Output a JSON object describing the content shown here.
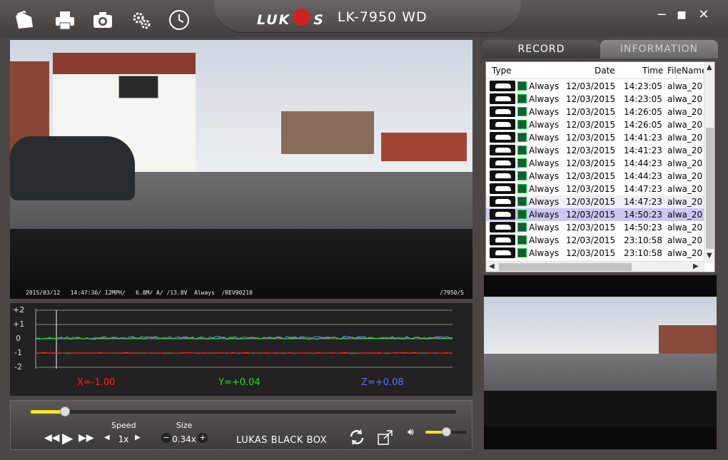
{
  "app": {
    "brand": "LUKAS",
    "model": "LK-7950 WD"
  },
  "toolbar": {
    "icons": [
      "open-folder-icon",
      "print-icon",
      "camera-icon",
      "settings-gears-icon",
      "clock-icon"
    ]
  },
  "window": {
    "minimize": "−",
    "maximize": "■",
    "close": "✕"
  },
  "main_video": {
    "osd_left": "2015/03/12   14:47:36/ 12MPH/   6.8M/ A/ /13.8V  Always  /REV90210",
    "osd_right": "/7950/S"
  },
  "gsensor": {
    "y_ticks": [
      "+2",
      "+1",
      "0",
      "-1",
      "-2"
    ],
    "x_label": "X=-1.00",
    "y_label": "Y=+0.04",
    "z_label": "Z=+0.08",
    "colors": {
      "x": "#ff2020",
      "y": "#20e020",
      "z": "#6a6aff"
    }
  },
  "controls": {
    "speed_label": "Speed",
    "speed_value": "1x",
    "size_label": "Size",
    "size_value": "0.34x",
    "minus": "−",
    "plus": "+",
    "footer_brand": "LUKAS BLACK BOX",
    "seek_progress": 0.08,
    "volume": 0.5
  },
  "tabs": {
    "record": "RECORD",
    "information": "INFORMATION"
  },
  "list": {
    "columns": {
      "type": "Type",
      "date": "Date",
      "time": "Time",
      "filename": "FileName"
    },
    "rows": [
      {
        "type": "Always",
        "date": "12/03/2015",
        "time": "14:23:05",
        "file": "alwa_20"
      },
      {
        "type": "Always",
        "date": "12/03/2015",
        "time": "14:23:05",
        "file": "alwa_20"
      },
      {
        "type": "Always",
        "date": "12/03/2015",
        "time": "14:26:05",
        "file": "alwa_20"
      },
      {
        "type": "Always",
        "date": "12/03/2015",
        "time": "14:26:05",
        "file": "alwa_20"
      },
      {
        "type": "Always",
        "date": "12/03/2015",
        "time": "14:41:23",
        "file": "alwa_20"
      },
      {
        "type": "Always",
        "date": "12/03/2015",
        "time": "14:41:23",
        "file": "alwa_20"
      },
      {
        "type": "Always",
        "date": "12/03/2015",
        "time": "14:44:23",
        "file": "alwa_20"
      },
      {
        "type": "Always",
        "date": "12/03/2015",
        "time": "14:44:23",
        "file": "alwa_20"
      },
      {
        "type": "Always",
        "date": "12/03/2015",
        "time": "14:47:23",
        "file": "alwa_20"
      },
      {
        "type": "Always",
        "date": "12/03/2015",
        "time": "14:47:23",
        "file": "alwa_20"
      },
      {
        "type": "Always",
        "date": "12/03/2015",
        "time": "14:50:23",
        "file": "alwa_20"
      },
      {
        "type": "Always",
        "date": "12/03/2015",
        "time": "14:50:23",
        "file": "alwa_20"
      },
      {
        "type": "Always",
        "date": "12/03/2015",
        "time": "23:10:58",
        "file": "alwa_20"
      },
      {
        "type": "Always",
        "date": "12/03/2015",
        "time": "23:10:58",
        "file": "alwa_20"
      }
    ],
    "selected_index": 10,
    "alt_index": 9
  }
}
